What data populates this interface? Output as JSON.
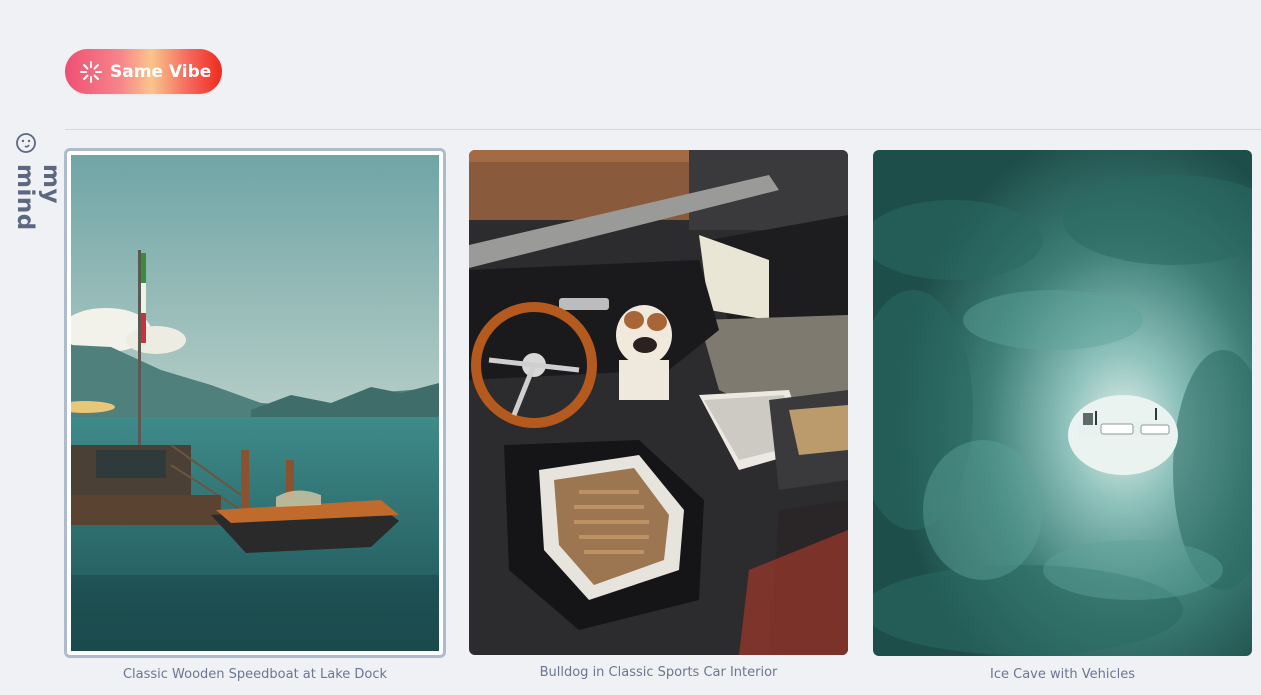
{
  "sidebar": {
    "label": "my mind",
    "icon": "mind-face-icon"
  },
  "vibe_button": {
    "label": "Same Vibe",
    "icon": "sparkle-burst-icon"
  },
  "gallery": {
    "items": [
      {
        "caption": "Classic Wooden Speedboat at Lake Dock",
        "selected": true
      },
      {
        "caption": "Bulldog in Classic Sports Car Interior",
        "selected": false
      },
      {
        "caption": "Ice Cave with Vehicles",
        "selected": false
      }
    ]
  },
  "colors": {
    "background": "#eff1f5",
    "selection_border": "#aebbcc",
    "caption_text": "#6b7690"
  }
}
